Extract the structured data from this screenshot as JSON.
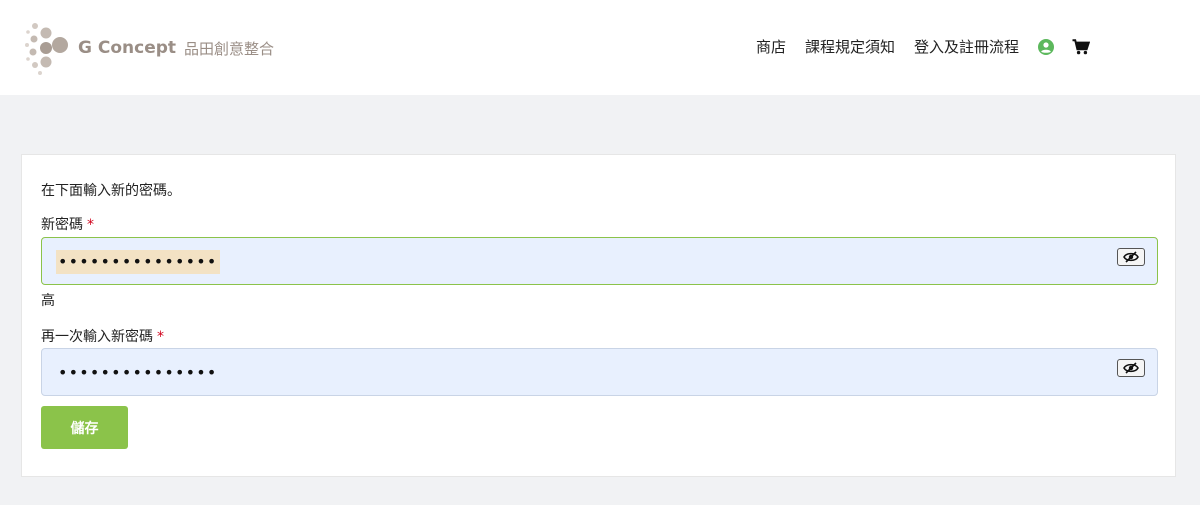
{
  "brand": {
    "name": "G Concept",
    "subtitle": "品田創意整合",
    "color": "#9a8e86"
  },
  "nav": {
    "items": [
      {
        "label": "商店"
      },
      {
        "label": "課程規定須知"
      },
      {
        "label": "登入及註冊流程"
      }
    ],
    "account_icon": "user-circle-icon",
    "cart_icon": "shopping-cart-icon",
    "account_color": "#5cb85c"
  },
  "form": {
    "intro": "在下面輸入新的密碼。",
    "new_password_label": "新密碼",
    "new_password_value": "•••••••••••••••",
    "strength_text": "高",
    "confirm_password_label": "再一次輸入新密碼",
    "confirm_password_value": "•••••••••••••••",
    "required_mark": "*",
    "save_label": "儲存",
    "accent_color": "#8bc34a"
  }
}
